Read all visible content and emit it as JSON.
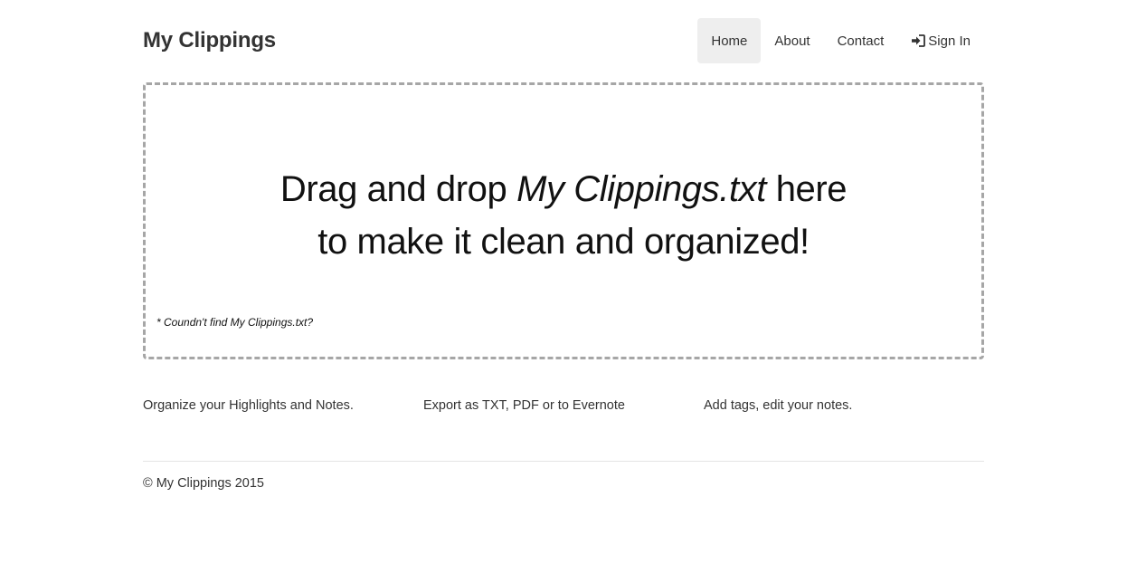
{
  "header": {
    "brand": "My Clippings",
    "nav": [
      {
        "label": "Home",
        "active": true
      },
      {
        "label": "About",
        "active": false
      },
      {
        "label": "Contact",
        "active": false
      },
      {
        "label": "Sign In",
        "active": false,
        "icon": "sign-in-icon"
      }
    ]
  },
  "dropzone": {
    "line1_before": "Drag and drop ",
    "line1_file": "My Clippings.txt",
    "line1_after": " here",
    "line2": "to make it clean and organized!",
    "hint": "* Coundn't find My Clippings.txt?"
  },
  "features": [
    "Organize your Highlights and Notes.",
    "Export as TXT, PDF or to Evernote",
    "Add tags, edit your notes."
  ],
  "footer": {
    "copyright": "© My Clippings 2015"
  },
  "colors": {
    "nav_active_bg": "#eeeeee",
    "dropzone_border": "#a6a6a6",
    "text": "#333333"
  }
}
